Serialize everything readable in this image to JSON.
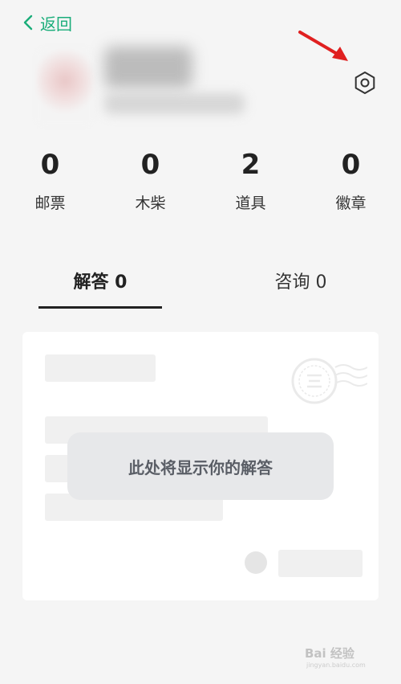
{
  "header": {
    "back_label": "返回",
    "icons": {
      "back": "chevron-left-icon",
      "settings": "gear-icon",
      "annotation": "red-arrow"
    }
  },
  "colors": {
    "accent": "#1aad7a",
    "arrow": "#e02020",
    "background": "#f5f5f5"
  },
  "stats": [
    {
      "value": "0",
      "label": "邮票"
    },
    {
      "value": "0",
      "label": "木柴"
    },
    {
      "value": "2",
      "label": "道具"
    },
    {
      "value": "0",
      "label": "徽章"
    }
  ],
  "tabs": [
    {
      "label": "解答 0",
      "active": true
    },
    {
      "label": "咨询 0",
      "active": false
    }
  ],
  "empty_state": {
    "message": "此处将显示你的解答"
  },
  "watermark": {
    "text": "Bai 经验",
    "sub": "jingyan.baidu.com"
  }
}
